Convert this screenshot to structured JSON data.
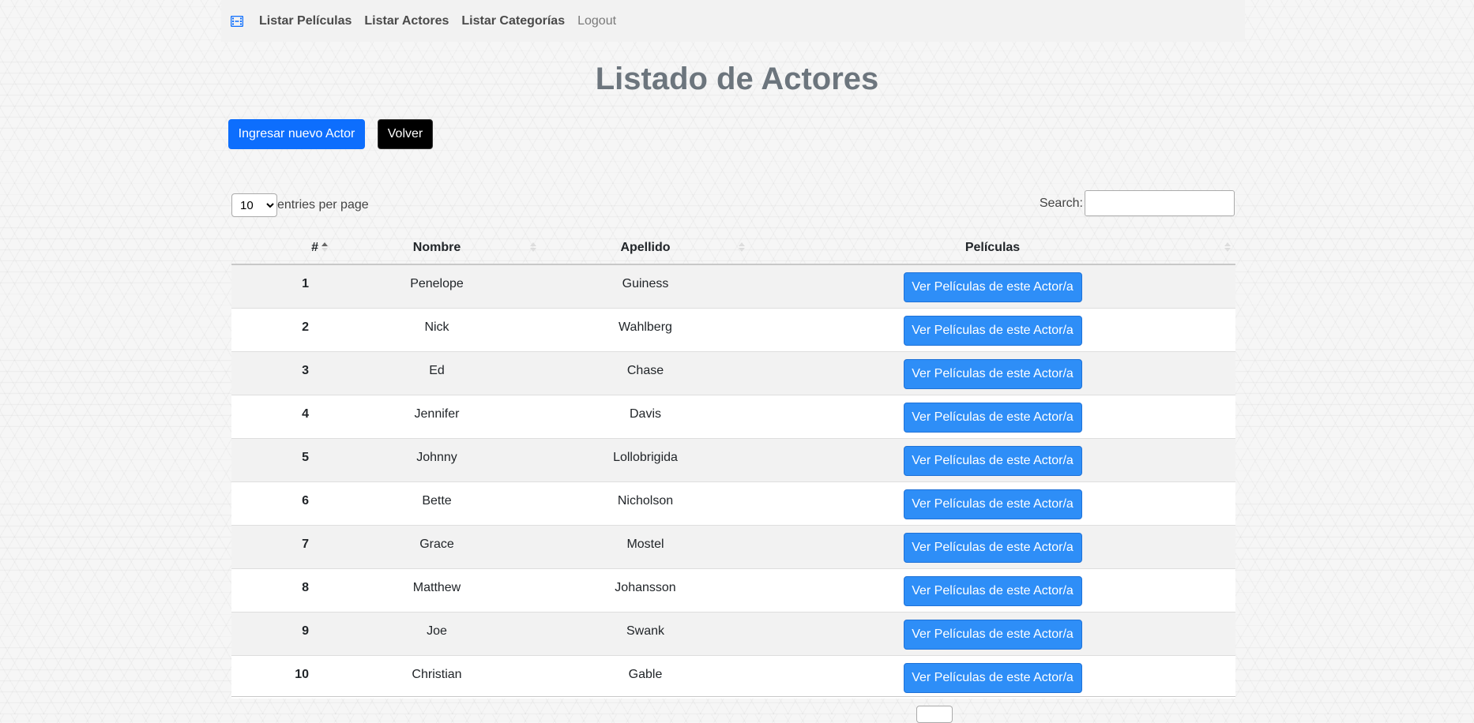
{
  "nav": {
    "brand_icon": "film-icon",
    "links": [
      "Listar Películas",
      "Listar Actores",
      "Listar Categorías"
    ],
    "logout": "Logout"
  },
  "page": {
    "title": "Listado de Actores",
    "new_button": "Ingresar nuevo Actor",
    "back_button": "Volver"
  },
  "table_controls": {
    "page_length": "10",
    "page_length_suffix": "entries per page",
    "search_label": "Search:"
  },
  "table": {
    "columns": [
      "#",
      "Nombre",
      "Apellido",
      "Películas"
    ],
    "sort": {
      "column": "#",
      "direction": "ascending"
    },
    "action_label": "Ver Películas de este Actor/a",
    "rows": [
      {
        "id": "1",
        "nombre": "Penelope",
        "apellido": "Guiness"
      },
      {
        "id": "2",
        "nombre": "Nick",
        "apellido": "Wahlberg"
      },
      {
        "id": "3",
        "nombre": "Ed",
        "apellido": "Chase"
      },
      {
        "id": "4",
        "nombre": "Jennifer",
        "apellido": "Davis"
      },
      {
        "id": "5",
        "nombre": "Johnny",
        "apellido": "Lollobrigida"
      },
      {
        "id": "6",
        "nombre": "Bette",
        "apellido": "Nicholson"
      },
      {
        "id": "7",
        "nombre": "Grace",
        "apellido": "Mostel"
      },
      {
        "id": "8",
        "nombre": "Matthew",
        "apellido": "Johansson"
      },
      {
        "id": "9",
        "nombre": "Joe",
        "apellido": "Swank"
      },
      {
        "id": "10",
        "nombre": "Christian",
        "apellido": "Gable"
      }
    ]
  },
  "colors": {
    "primary": "#0d6efd",
    "action_button": "#2e8ef7",
    "dark_button": "#000000",
    "title": "#6c757d"
  }
}
